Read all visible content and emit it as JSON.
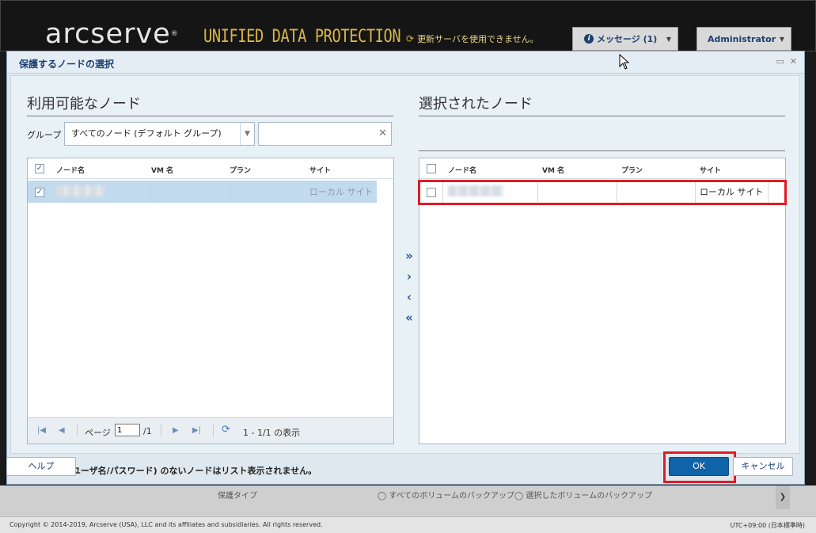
{
  "app": {
    "logo": "arcserve",
    "logo_reg": "®",
    "product": "UNIFIED DATA PROTECTION",
    "update_message": "更新サーバを使用できません。",
    "messages_label": "メッセージ (1)",
    "user_label": "Administrator",
    "background_row_label": "保護タイプ",
    "background_radio_1": "すべてのボリュームのバックアップ",
    "background_radio_2": "選択したボリュームのバックアップ",
    "copyright": "Copyright © 2014-2019, Arcserve (USA), LLC and its affiliates and subsidiaries. All rights reserved.",
    "timezone": "UTC+09:00 (日本標準時)"
  },
  "dialog": {
    "title": "保護するノードの選択",
    "available": {
      "title": "利用可能なノード",
      "group_label": "グループ",
      "group_value": "すべてのノード (デフォルト グループ)",
      "filter_value": "",
      "columns": [
        "ノード名",
        "VM 名",
        "プラン",
        "サイト"
      ],
      "rows": [
        {
          "checked": true,
          "node": "",
          "vm": "",
          "plan": "",
          "site": "ローカル サイト"
        }
      ],
      "pager": {
        "page_label": "ページ",
        "page_value": "1",
        "page_total": "/1",
        "summary": "1 - 1/1 の表示"
      }
    },
    "selected": {
      "title": "選択されたノード",
      "columns": [
        "ノード名",
        "VM 名",
        "プラン",
        "サイト"
      ],
      "rows": [
        {
          "checked": false,
          "node": "",
          "vm": "",
          "plan": "",
          "site": "ローカル サイト"
        }
      ]
    },
    "move_buttons": {
      "add_all": "»",
      "add": "›",
      "remove": "‹",
      "remove_all": "«"
    },
    "note": "認証情報 (ユーザ名/パスワード) のないノードはリスト表示されません。",
    "buttons": {
      "help": "ヘルプ",
      "ok": "OK",
      "cancel": "キャンセル"
    }
  },
  "colors": {
    "accent": "#0f63a8",
    "highlight": "#e11b22",
    "title_text": "#1e3f72"
  }
}
